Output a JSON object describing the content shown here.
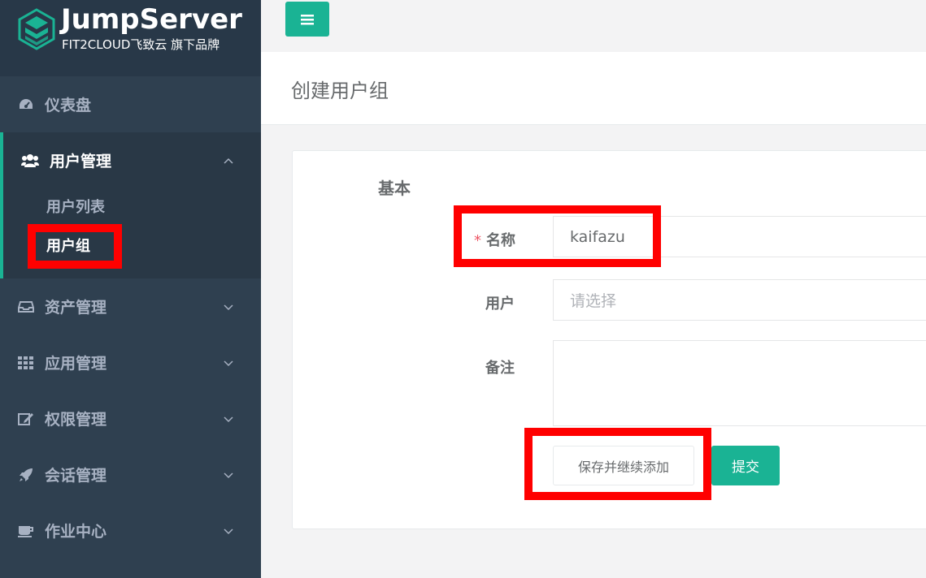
{
  "brand": {
    "title": "JumpServer",
    "subtitle": "FIT2CLOUD飞致云 旗下品牌"
  },
  "sidebar": {
    "items": [
      {
        "label": "仪表盘",
        "icon": "dashboard-icon"
      },
      {
        "label": "用户管理",
        "icon": "users-icon",
        "expanded": true,
        "children": [
          {
            "label": "用户列表"
          },
          {
            "label": "用户组"
          }
        ]
      },
      {
        "label": "资产管理",
        "icon": "inbox-icon"
      },
      {
        "label": "应用管理",
        "icon": "grid-icon"
      },
      {
        "label": "权限管理",
        "icon": "edit-icon"
      },
      {
        "label": "会话管理",
        "icon": "rocket-icon"
      },
      {
        "label": "作业中心",
        "icon": "coffee-icon"
      }
    ]
  },
  "page": {
    "title": "创建用户组"
  },
  "form": {
    "section": "基本",
    "name_label": "名称",
    "name_value": "kaifazu",
    "users_label": "用户",
    "users_placeholder": "请选择",
    "comment_label": "备注",
    "save_continue_label": "保存并继续添加",
    "submit_label": "提交"
  },
  "colors": {
    "accent": "#1ab394",
    "sidebar": "#2f4050",
    "highlight": "#ff0000"
  }
}
